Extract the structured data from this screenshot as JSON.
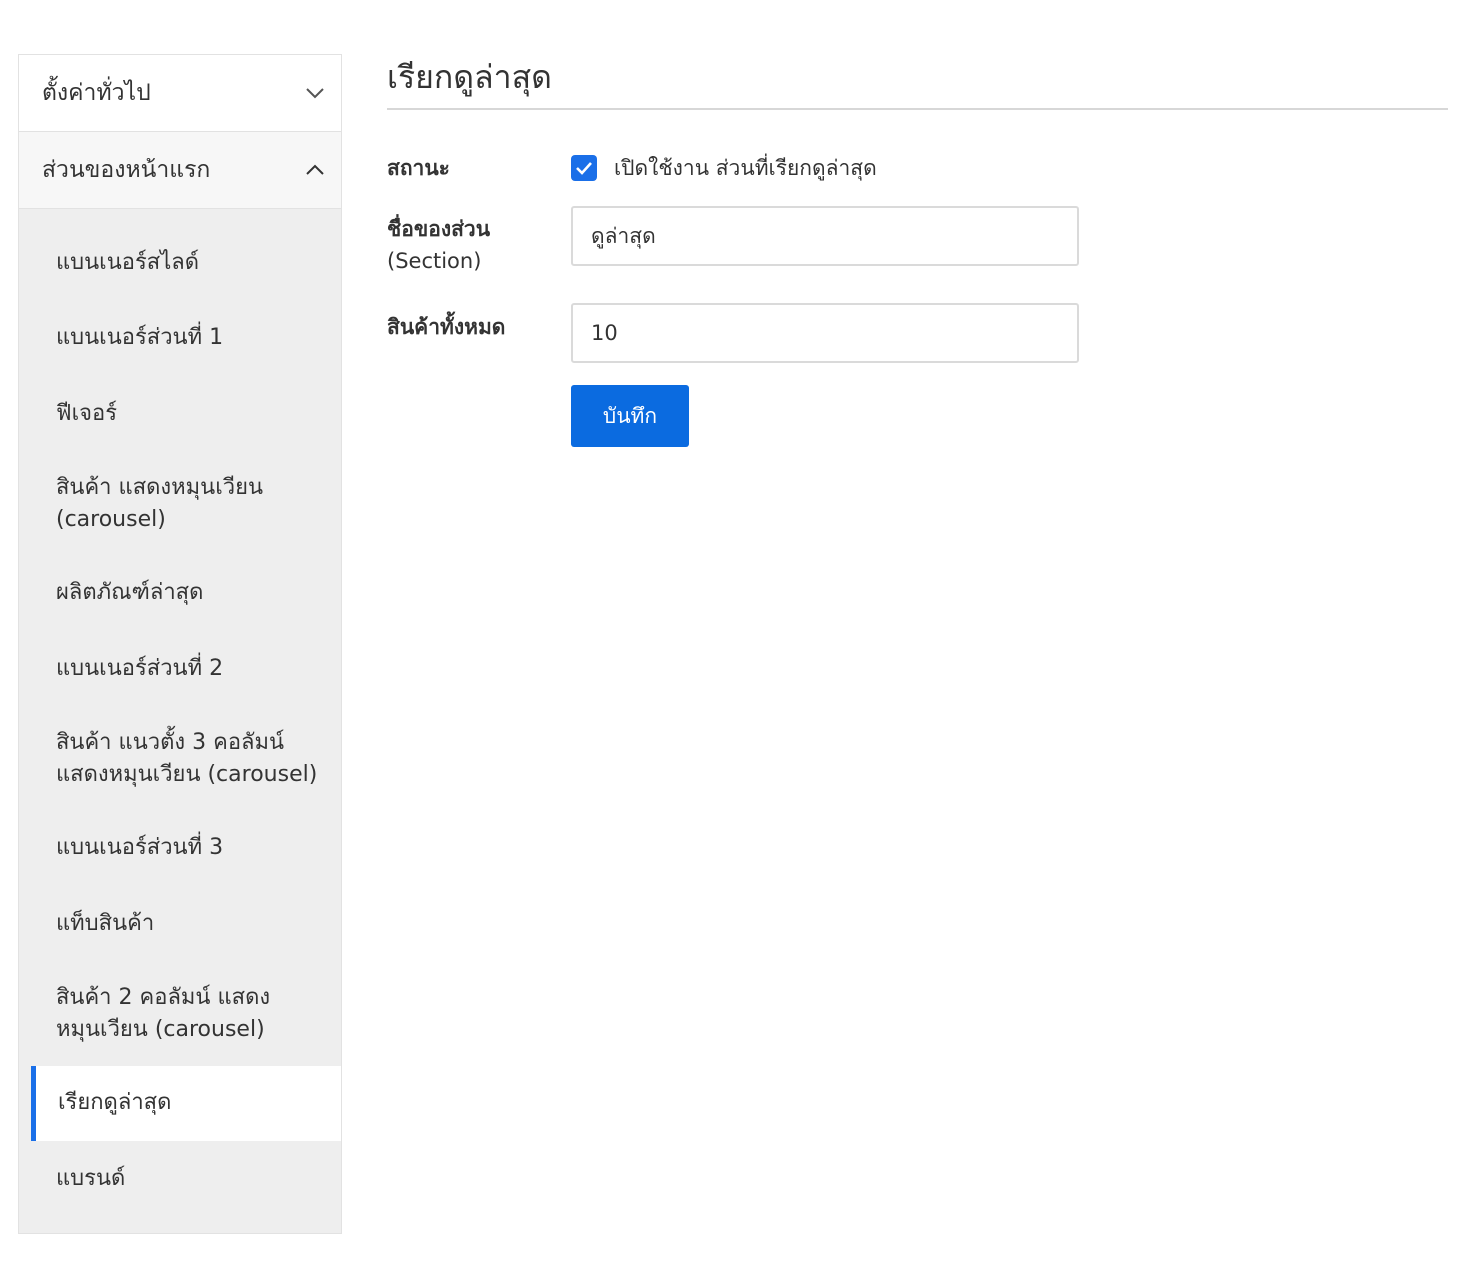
{
  "sidebar": {
    "general": {
      "label": "ตั้งค่าทั่วไป",
      "icon": "chevron-down-icon"
    },
    "sections": {
      "label": "ส่วนของหน้าแรก",
      "icon": "chevron-up-icon"
    },
    "items": [
      {
        "label": "แบนเนอร์สไลด์"
      },
      {
        "label": "แบนเนอร์ส่วนที่ 1"
      },
      {
        "label": "ฟีเจอร์"
      },
      {
        "label": "สินค้า แสดงหมุนเวียน (carousel)"
      },
      {
        "label": "ผลิตภัณฑ์ล่าสุด"
      },
      {
        "label": "แบนเนอร์ส่วนที่ 2"
      },
      {
        "label": "สินค้า แนวตั้ง 3 คอลัมน์ แสดงหมุนเวียน (carousel)"
      },
      {
        "label": "แบนเนอร์ส่วนที่ 3"
      },
      {
        "label": "แท็บสินค้า"
      },
      {
        "label": "สินค้า 2 คอลัมน์ แสดง หมุนเวียน (carousel)"
      },
      {
        "label": "เรียกดูล่าสุด"
      },
      {
        "label": "แบรนด์"
      }
    ],
    "active_index": 10
  },
  "main": {
    "title": "เรียกดูล่าสุด",
    "status": {
      "label": "สถานะ",
      "checked": true,
      "checkbox_text": "เปิดใช้งาน ส่วนที่เรียกดูล่าสุด"
    },
    "section_name": {
      "label": "ชื่อของส่วน",
      "label_sub": "(Section)",
      "value": "ดูล่าสุด"
    },
    "total_products": {
      "label": "สินค้าทั้งหมด",
      "value": "10"
    },
    "save_label": "บันทึก"
  },
  "colors": {
    "accent": "#1a6fe8",
    "button": "#0b6be0",
    "submenu_bg": "#eeeeee"
  }
}
